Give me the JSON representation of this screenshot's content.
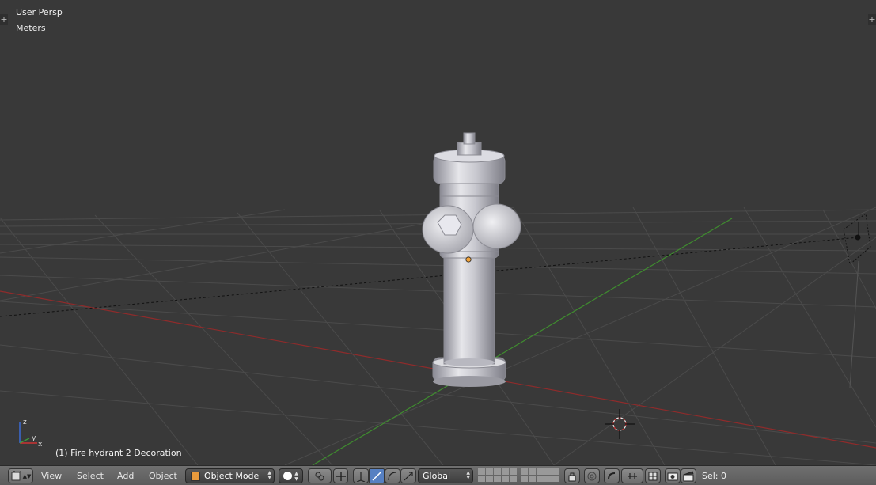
{
  "viewport": {
    "view_name": "User Persp",
    "units": "Meters",
    "object_info": "(1) Fire hydrant 2 Decoration",
    "axes": {
      "x": "x",
      "y": "y",
      "z": "z"
    }
  },
  "header": {
    "menus": [
      "View",
      "Select",
      "Add",
      "Object"
    ],
    "mode": "Object Mode",
    "orientation": "Global",
    "selection_count": "Sel: 0"
  },
  "colors": {
    "background": "#393939",
    "grid": "#4a4a4a",
    "x_axis": "#8f2b2b",
    "y_axis": "#3f8c2f",
    "header": "#666666",
    "active_toggle": "#5680c2"
  },
  "icons": [
    "editor-type-icon",
    "shading-sphere-icon",
    "pivot-icon",
    "manipulator-icon",
    "translate-icon",
    "rotate-icon",
    "scale-icon",
    "layers-icon",
    "lock-icon",
    "proportional-icon",
    "snap-icon",
    "snap-target-icon",
    "render-icon",
    "clapper-icon"
  ]
}
